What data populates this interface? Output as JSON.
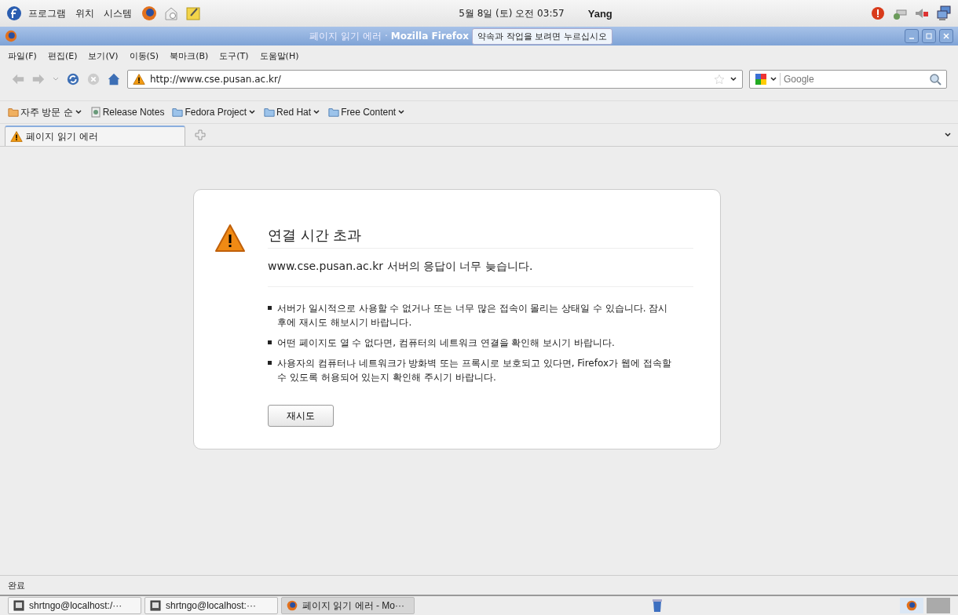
{
  "top_panel": {
    "menus": [
      "프로그램",
      "위치",
      "시스템"
    ],
    "clock": "5월  8일 (토) 오전 03:57",
    "user": "Yang"
  },
  "window": {
    "title": "페이지 읽기 에러 ·",
    "app": "Mozilla Firefox",
    "tooltip": "약속과 작업을 보려면 누르십시오"
  },
  "menu": [
    "파일(F)",
    "편집(E)",
    "보기(V)",
    "이동(S)",
    "북마크(B)",
    "도구(T)",
    "도움말(H)"
  ],
  "address": {
    "value": "http://www.cse.pusan.ac.kr/"
  },
  "search": {
    "placeholder": "Google"
  },
  "bookmarks": [
    {
      "label": "자주 방문 순",
      "kind": "feed",
      "dropdown": true
    },
    {
      "label": "Release Notes",
      "kind": "page",
      "dropdown": false
    },
    {
      "label": "Fedora Project",
      "kind": "folder",
      "dropdown": true
    },
    {
      "label": "Red Hat",
      "kind": "folder",
      "dropdown": true
    },
    {
      "label": "Free Content",
      "kind": "folder",
      "dropdown": true
    }
  ],
  "tabs": [
    {
      "label": "페이지 읽기 에러",
      "selected": true
    }
  ],
  "error": {
    "title": "연결 시간 초과",
    "message": "www.cse.pusan.ac.kr 서버의 응답이 너무 늦습니다.",
    "bullets": [
      "서버가 일시적으로 사용할 수 없거나 또는 너무 많은 접속이 몰리는 상태일 수 있습니다. 잠시 후에 재시도 해보시기 바랍니다.",
      "어떤 페이지도 열 수 없다면, 컴퓨터의 네트워크 연결을 확인해 보시기 바랍니다.",
      "사용자의 컴퓨터나 네트워크가 방화벽 또는 프록시로 보호되고 있다면, Firefox가 웹에 접속할 수 있도록 허용되어 있는지 확인해 주시기 바랍니다."
    ],
    "button": "재시도"
  },
  "status": "완료",
  "taskbar": [
    {
      "label": "shrtngo@localhost:/···",
      "kind": "terminal",
      "selected": false
    },
    {
      "label": "shrtngo@localhost:···",
      "kind": "terminal",
      "selected": false
    },
    {
      "label": "페이지 읽기 에러 - Mo···",
      "kind": "browser",
      "selected": true
    }
  ]
}
